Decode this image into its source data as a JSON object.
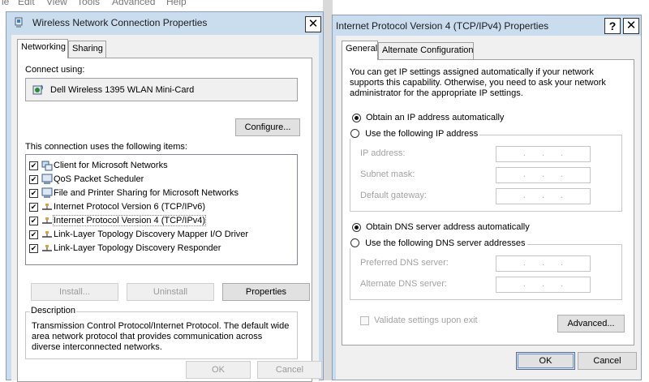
{
  "menubar": [
    "le",
    "Edit",
    "View",
    "Tools",
    "Advanced",
    "Help"
  ],
  "left_window": {
    "title": "Wireless Network Connection Properties",
    "icon": "network-adapter-icon",
    "tabs": [
      "Networking",
      "Sharing"
    ],
    "connect_using_label": "Connect using:",
    "adapter_name": "Dell Wireless 1395 WLAN Mini-Card",
    "configure_button": "Configure...",
    "items_label": "This connection uses the following items:",
    "items": [
      {
        "label": "Client for Microsoft Networks",
        "checked": true,
        "icon": "network-client-icon"
      },
      {
        "label": "QoS Packet Scheduler",
        "checked": true,
        "icon": "network-service-icon"
      },
      {
        "label": "File and Printer Sharing for Microsoft Networks",
        "checked": true,
        "icon": "network-service-icon"
      },
      {
        "label": "Internet Protocol Version 6 (TCP/IPv6)",
        "checked": true,
        "icon": "protocol-icon"
      },
      {
        "label": "Internet Protocol Version 4 (TCP/IPv4)",
        "checked": true,
        "icon": "protocol-icon",
        "selected": true
      },
      {
        "label": "Link-Layer Topology Discovery Mapper I/O Driver",
        "checked": true,
        "icon": "protocol-icon"
      },
      {
        "label": "Link-Layer Topology Discovery Responder",
        "checked": true,
        "icon": "protocol-icon"
      }
    ],
    "install_button": "Install...",
    "uninstall_button": "Uninstall",
    "properties_button": "Properties",
    "description_title": "Description",
    "description_text": "Transmission Control Protocol/Internet Protocol. The default wide area network protocol that provides communication across diverse interconnected networks.",
    "ok_button": "OK",
    "cancel_button": "Cancel"
  },
  "right_window": {
    "title": "Internet Protocol Version 4 (TCP/IPv4) Properties",
    "help_button": "?",
    "tabs": [
      "General",
      "Alternate Configuration"
    ],
    "intro_text": "You can get IP settings assigned automatically if your network supports this capability. Otherwise, you need to ask your network administrator for the appropriate IP settings.",
    "obtain_ip_auto": "Obtain an IP address automatically",
    "use_following_ip": "Use the following IP address",
    "ip_selection": "auto",
    "ip_address_label": "IP address:",
    "subnet_mask_label": "Subnet mask:",
    "default_gateway_label": "Default gateway:",
    "obtain_dns_auto": "Obtain DNS server address automatically",
    "use_following_dns": "Use the following DNS server addresses",
    "dns_selection": "auto",
    "preferred_dns_label": "Preferred DNS server:",
    "alternate_dns_label": "Alternate DNS server:",
    "ip_placeholder": "...",
    "validate_label": "Validate settings upon exit",
    "validate_checked": false,
    "advanced_button": "Advanced...",
    "ok_button": "OK",
    "cancel_button": "Cancel"
  }
}
